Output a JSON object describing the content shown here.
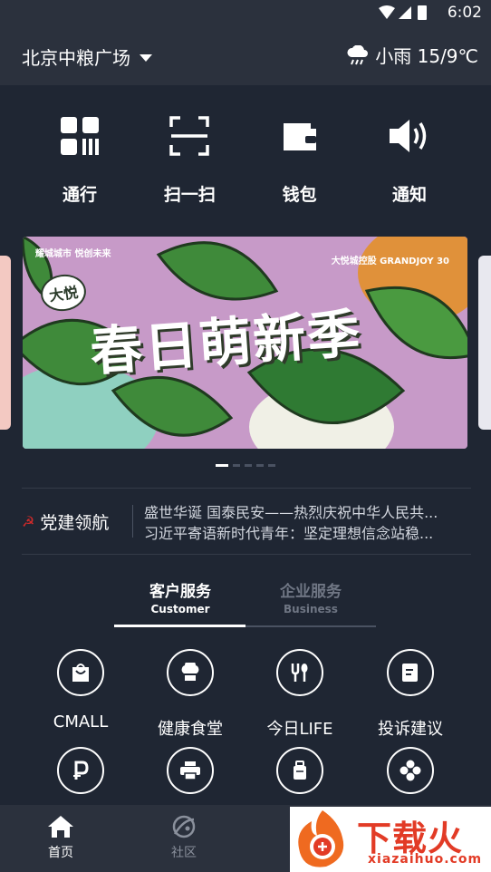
{
  "status_bar": {
    "time": "6:02"
  },
  "header": {
    "location": "北京中粮广场",
    "weather": "小雨 15/9℃",
    "weather_icon": "cloud-rain-icon"
  },
  "quick_actions": [
    {
      "label": "通行",
      "icon": "qr-code-icon"
    },
    {
      "label": "扫一扫",
      "icon": "scan-icon"
    },
    {
      "label": "钱包",
      "icon": "wallet-icon"
    },
    {
      "label": "通知",
      "icon": "speaker-icon"
    }
  ],
  "banner": {
    "headline": "春日萌新季",
    "badge": "大悦",
    "brand_left": "耀城城市 悦创未来",
    "brand_right": "大悦城控股 GRANDJOY 30",
    "page_count": 5,
    "active_page": 1
  },
  "news": {
    "tag": "党建领航",
    "items": [
      "盛世华诞 国泰民安——热烈庆祝中华人民共...",
      "习近平寄语新时代青年：坚定理想信念站稳..."
    ]
  },
  "tabs": [
    {
      "cn": "客户服务",
      "en": "Customer",
      "active": true
    },
    {
      "cn": "企业服务",
      "en": "Business",
      "active": false
    }
  ],
  "services": [
    {
      "label": "CMALL",
      "icon": "shopping-bag-icon"
    },
    {
      "label": "健康食堂",
      "icon": "chef-hat-icon"
    },
    {
      "label": "今日LIFE",
      "icon": "cutlery-icon"
    },
    {
      "label": "投诉建议",
      "icon": "edit-note-icon"
    },
    {
      "label": "",
      "icon": "parking-icon"
    },
    {
      "label": "",
      "icon": "printer-icon"
    },
    {
      "label": "",
      "icon": "bag-icon"
    },
    {
      "label": "",
      "icon": "clover-icon"
    }
  ],
  "bottom_nav": [
    {
      "label": "首页",
      "icon": "home-icon",
      "active": true
    },
    {
      "label": "社区",
      "icon": "planet-icon",
      "active": false
    }
  ],
  "watermark": {
    "cn": "下载火",
    "en": "xiazaihuo.com"
  }
}
